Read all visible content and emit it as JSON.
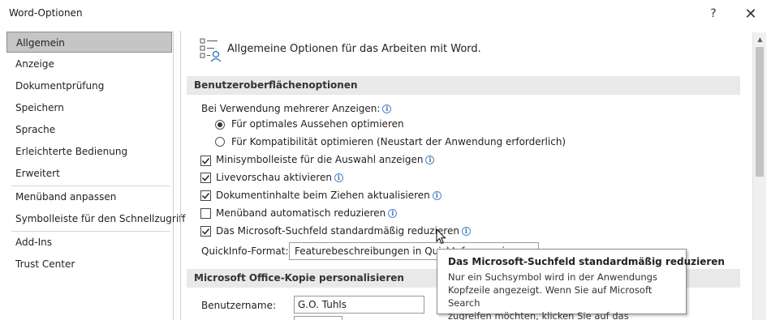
{
  "window": {
    "title": "Word-Optionen",
    "help_icon": "?",
    "close_icon": "✕"
  },
  "nav": {
    "items": [
      {
        "label": "Allgemein",
        "selected": true
      },
      {
        "label": "Anzeige"
      },
      {
        "label": "Dokumentprüfung"
      },
      {
        "label": "Speichern"
      },
      {
        "label": "Sprache"
      },
      {
        "label": "Erleichterte Bedienung"
      },
      {
        "label": "Erweitert"
      },
      {
        "label": "Menüband anpassen"
      },
      {
        "label": "Symbolleiste für den Schnellzugriff"
      },
      {
        "label": "Add-Ins"
      },
      {
        "label": "Trust Center"
      }
    ]
  },
  "header": {
    "text": "Allgemeine Optionen für das Arbeiten mit Word.",
    "icon": "general-options-icon"
  },
  "sections": {
    "ui_options": "Benutzeroberflächenoptionen",
    "personalize": "Microsoft Office-Kopie personalisieren"
  },
  "ui": {
    "multi_display_label": "Bei Verwendung mehrerer Anzeigen:",
    "radio_optimal": {
      "label": "Für optimales Aussehen optimieren",
      "checked": true
    },
    "radio_compat": {
      "label": "Für Kompatibilität optimieren (Neustart der Anwendung erforderlich)",
      "checked": false
    },
    "checkboxes": [
      {
        "label": "Minisymbolleiste für die Auswahl anzeigen",
        "checked": true
      },
      {
        "label": "Livevorschau aktivieren",
        "checked": true
      },
      {
        "label": "Dokumentinhalte beim Ziehen aktualisieren",
        "checked": true
      },
      {
        "label": "Menüband automatisch reduzieren",
        "checked": false
      },
      {
        "label": "Das Microsoft-Suchfeld standardmäßig reduzieren",
        "checked": true
      }
    ],
    "quickinfo_label": "QuickInfo-Format:",
    "quickinfo_value": "Featurebeschreibungen in QuickInfos anzeigen"
  },
  "personalize": {
    "username_label": "Benutzername:",
    "username_value": "G.O. Tuhls"
  },
  "tooltip": {
    "title": "Das Microsoft-Suchfeld standardmäßig reduzieren",
    "body": "Nur ein Suchsymbol wird in der Anwendungs\nKopfzeile angezeigt. Wenn Sie auf Microsoft Search\nzugreifen möchten, klicken Sie auf das Suchsymbol."
  },
  "colors": {
    "selected_nav_bg": "#c5c5c5",
    "section_bg": "#e9e9e9",
    "info_icon": "#2f6fb5"
  }
}
